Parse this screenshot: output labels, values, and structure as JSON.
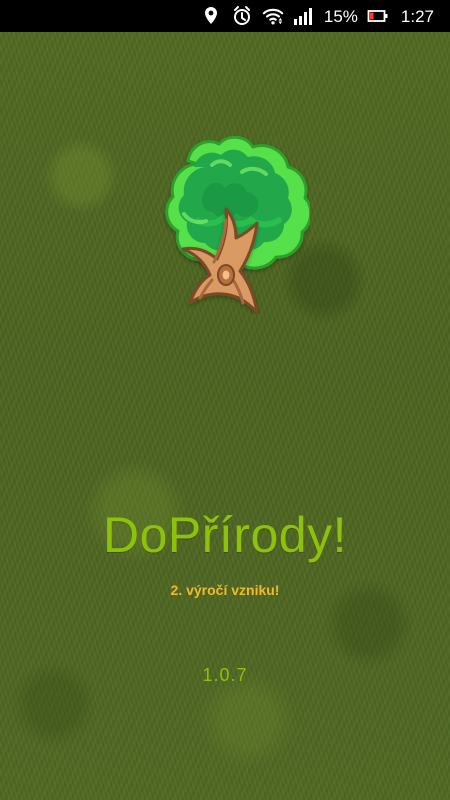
{
  "status_bar": {
    "battery_percent": "15%",
    "time": "1:27",
    "icons": [
      "location-icon",
      "alarm-icon",
      "wifi-icon",
      "signal-icon",
      "battery-icon"
    ]
  },
  "splash": {
    "logo_icon": "tree-icon",
    "title": "DoPřírody!",
    "subtitle": "2. výročí vzniku!",
    "version": "1.0.7"
  },
  "colors": {
    "title": "#8dc10c",
    "subtitle": "#f1b92b",
    "grass": "#4c6320",
    "status_bar": "#000000"
  }
}
